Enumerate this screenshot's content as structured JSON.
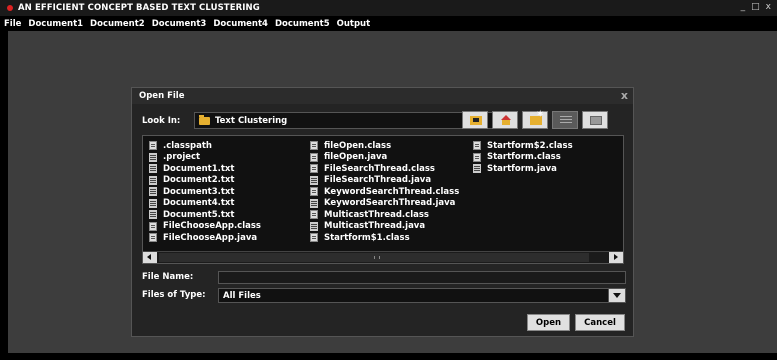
{
  "window": {
    "title": "AN EFFICIENT CONCEPT BASED TEXT CLUSTERING",
    "controls": [
      "_",
      "□",
      "x"
    ]
  },
  "menu": [
    "File",
    "Document1",
    "Document2",
    "Document3",
    "Document4",
    "Document5",
    "Output"
  ],
  "dialog": {
    "title": "Open File",
    "close": "x",
    "look_in_label": "Look In:",
    "look_in_value": "Text Clustering",
    "toolbar": [
      "folder-up-icon",
      "home-icon",
      "new-folder-icon",
      "list-view-icon",
      "details-view-icon"
    ],
    "files": [
      [
        {
          "name": ".classpath",
          "kind": "cls"
        },
        {
          "name": ".project",
          "kind": "txt"
        },
        {
          "name": "Document1.txt",
          "kind": "txt"
        },
        {
          "name": "Document2.txt",
          "kind": "txt"
        },
        {
          "name": "Document3.txt",
          "kind": "txt"
        },
        {
          "name": "Document4.txt",
          "kind": "txt"
        },
        {
          "name": "Document5.txt",
          "kind": "txt"
        },
        {
          "name": "FileChooseApp.class",
          "kind": "cls"
        },
        {
          "name": "FileChooseApp.java",
          "kind": "cls"
        }
      ],
      [
        {
          "name": "fileOpen.class",
          "kind": "cls"
        },
        {
          "name": "fileOpen.java",
          "kind": "cls"
        },
        {
          "name": "FileSearchThread.class",
          "kind": "cls"
        },
        {
          "name": "FileSearchThread.java",
          "kind": "txt"
        },
        {
          "name": "KeywordSearchThread.class",
          "kind": "cls"
        },
        {
          "name": "KeywordSearchThread.java",
          "kind": "txt"
        },
        {
          "name": "MulticastThread.class",
          "kind": "cls"
        },
        {
          "name": "MulticastThread.java",
          "kind": "txt"
        },
        {
          "name": "Startform$1.class",
          "kind": "cls"
        }
      ],
      [
        {
          "name": "Startform$2.class",
          "kind": "cls"
        },
        {
          "name": "Startform.class",
          "kind": "cls"
        },
        {
          "name": "Startform.java",
          "kind": "txt"
        }
      ]
    ],
    "file_name_label": "File Name:",
    "file_name_value": "",
    "files_of_type_label": "Files of Type:",
    "files_of_type_value": "All Files",
    "open_label": "Open",
    "cancel_label": "Cancel"
  },
  "colors": {
    "desktop": "#3d3d3d",
    "dialog": "#242424",
    "list": "#111111",
    "folder": "#e6b030"
  }
}
